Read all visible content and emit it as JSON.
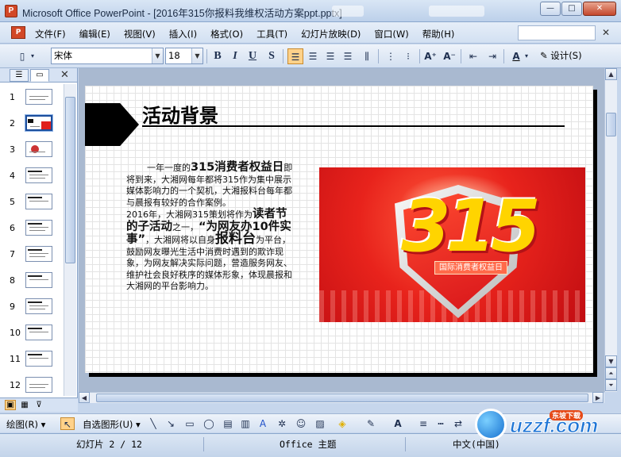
{
  "window": {
    "title": "Microsoft Office PowerPoint - [2016年315你报料我维权活动方案ppt.pptx]",
    "buttons": {
      "minimize": "—",
      "maximize": "□",
      "close": "✕"
    }
  },
  "menubar": {
    "items": [
      "文件(F)",
      "编辑(E)",
      "视图(V)",
      "插入(I)",
      "格式(O)",
      "工具(T)",
      "幻灯片放映(D)",
      "窗口(W)",
      "帮助(H)"
    ],
    "close_doc": "✕"
  },
  "toolbar": {
    "font_name": "宋体",
    "font_size": "18",
    "bold": "B",
    "italic": "I",
    "underline": "U",
    "shadow": "S",
    "increase_font": "A⁺",
    "decrease_font": "A⁻",
    "font_color": "A",
    "design_label": "设计(S)"
  },
  "leftpane": {
    "tab_outline_icon": "outline-icon",
    "tab_slides_icon": "slides-icon",
    "close": "✕",
    "slides": [
      "1",
      "2",
      "3",
      "4",
      "5",
      "6",
      "7",
      "8",
      "9",
      "10",
      "11",
      "12"
    ],
    "selected_slide": "2"
  },
  "slide": {
    "title": "活动背景",
    "text_pre1": "一年一度的",
    "text_big1": "315消费者权益日",
    "text_p1_rest": "即将到来，大湘网每年都将315作为集中展示媒体影响力的一个契机，大湘报料台每年都与晨报有较好的合作案例。",
    "text_p2_a": "2016年，大湘网315策划将作为",
    "text_big2": "读者节的子活动",
    "text_p2_b": "之一，",
    "text_big3": "“为网友办10件实事”",
    "text_p2_c": "，大湘网将以自身",
    "text_big4": "报料台",
    "text_p2_d": "为平台，鼓励网友曝光生活中消费时遇到的欺诈现象，为网友解决实际问题，营造服务网友、维护社会良好秩序的媒体形象，体现晨报和大湘网的平台影响力。",
    "image_number": "315",
    "image_banner": "国际消费者权益日"
  },
  "drawbar": {
    "draw_label": "绘图(R)",
    "autoshape_label": "自选图形(U)"
  },
  "statusbar": {
    "slide_info": "幻灯片 2 / 12",
    "theme": "Office 主题",
    "language": "中文(中国)"
  },
  "watermark": {
    "text": "uzzf.com",
    "tag": "东坡下载"
  },
  "colors": {
    "accent": "#1c4e9c",
    "image_red": "#e8231c",
    "number_yellow": "#ffd400"
  }
}
